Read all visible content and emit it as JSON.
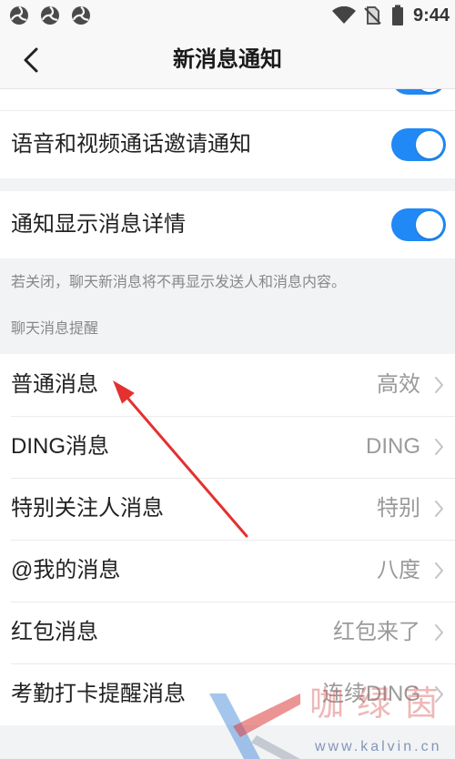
{
  "status_bar": {
    "time": "9:44",
    "notification_icons": [
      "app-notification-icon",
      "app-notification-icon",
      "app-notification-icon"
    ],
    "system_icons": [
      "wifi-icon",
      "no-sim-icon",
      "battery-icon"
    ]
  },
  "nav": {
    "back_icon": "chevron-left-icon",
    "title": "新消息通知"
  },
  "scrolled_row": {
    "toggle_on": true
  },
  "call_invite": {
    "label": "语音和视频通话邀请通知",
    "toggle_on": true
  },
  "message_details": {
    "label": "通知显示消息详情",
    "toggle_on": true,
    "hint": "若关闭，聊天新消息将不再显示发送人和消息内容。"
  },
  "chat_reminder": {
    "section_title": "聊天消息提醒",
    "chevron_icon": "chevron-right-icon",
    "items": [
      {
        "label": "普通消息",
        "value": "高效"
      },
      {
        "label": "DING消息",
        "value": "DING"
      },
      {
        "label": "特别关注人消息",
        "value": "特别"
      },
      {
        "label": "@我的消息",
        "value": "八度"
      },
      {
        "label": "红包消息",
        "value": "红包来了"
      },
      {
        "label": "考勤打卡提醒消息",
        "value": "连续DING"
      }
    ]
  },
  "colors": {
    "accent": "#2089f5",
    "annotation": "#e3312f",
    "page_background": "#f2f3f5"
  },
  "watermark": {
    "brand": "咖绿茵",
    "url": "www.kalvin.cn"
  }
}
